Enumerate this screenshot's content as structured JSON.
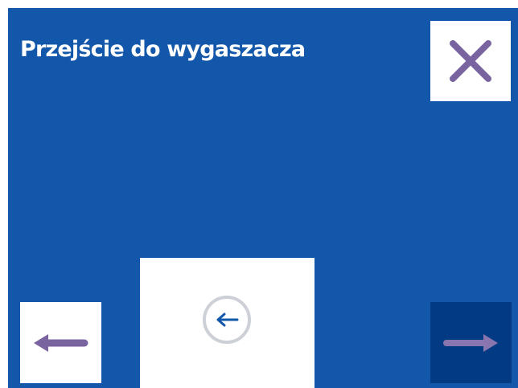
{
  "header": {
    "title": "Przejście do wygaszacza"
  },
  "icons": {
    "close": "close-icon",
    "previous": "arrow-left-icon",
    "back": "back-circle-icon",
    "next": "arrow-right-icon"
  },
  "colors": {
    "background": "#1257a9",
    "accent_purple": "#7a64a0",
    "next_button_bg": "#033a84",
    "next_arrow": "#8a76ae",
    "back_icon_ring": "#cdd0d6",
    "back_icon_arrow": "#1257a9"
  }
}
